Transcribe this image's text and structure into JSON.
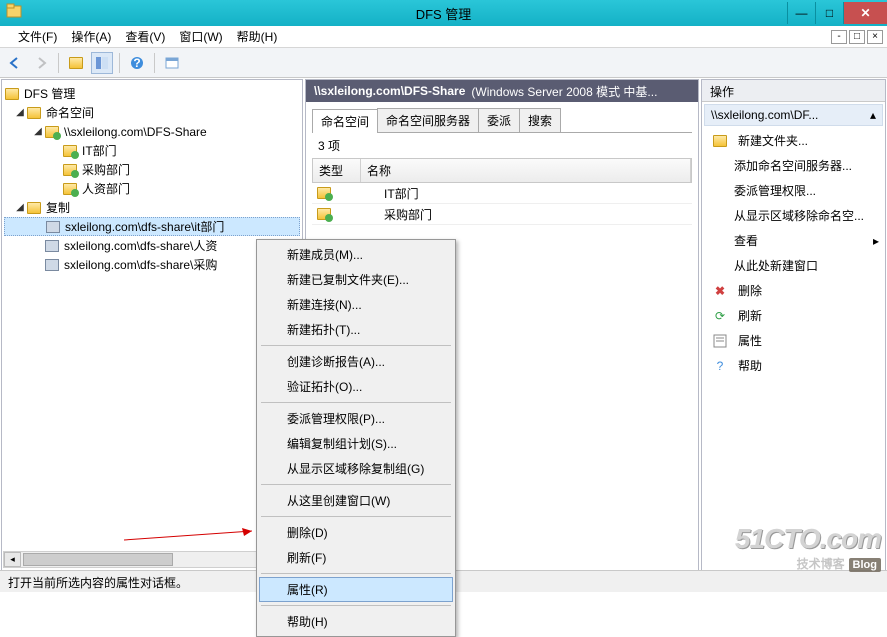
{
  "window": {
    "title": "DFS 管理"
  },
  "menu": {
    "file": "文件(F)",
    "action": "操作(A)",
    "view": "查看(V)",
    "window": "窗口(W)",
    "help": "帮助(H)"
  },
  "tree": {
    "root": "DFS 管理",
    "ns": "命名空间",
    "nsPath": "\\\\sxleilong.com\\DFS-Share",
    "nsChildren": [
      "IT部门",
      "采购部门",
      "人资部门"
    ],
    "rep": "复制",
    "repChildren": [
      "sxleilong.com\\dfs-share\\it部门",
      "sxleilong.com\\dfs-share\\人资",
      "sxleilong.com\\dfs-share\\采购"
    ]
  },
  "mid": {
    "path": "\\\\sxleilong.com\\DFS-Share",
    "sub": "(Windows Server 2008 模式 中基...",
    "tabs": [
      "命名空间",
      "命名空间服务器",
      "委派",
      "搜索"
    ],
    "count": "3 项",
    "cols": {
      "type": "类型",
      "name": "名称"
    },
    "rows": [
      "IT部门",
      "采购部门"
    ]
  },
  "actions": {
    "header": "操作",
    "group": "\\\\sxleilong.com\\DF...",
    "items": [
      "新建文件夹...",
      "添加命名空间服务器...",
      "委派管理权限...",
      "从显示区域移除命名空...",
      "查看",
      "从此处新建窗口",
      "删除",
      "刷新",
      "属性",
      "帮助"
    ]
  },
  "ctx": {
    "items1": [
      "新建成员(M)...",
      "新建已复制文件夹(E)...",
      "新建连接(N)...",
      "新建拓扑(T)..."
    ],
    "items2": [
      "创建诊断报告(A)...",
      "验证拓扑(O)..."
    ],
    "items3": [
      "委派管理权限(P)...",
      "编辑复制组计划(S)...",
      "从显示区域移除复制组(G)"
    ],
    "items4": [
      "从这里创建窗口(W)"
    ],
    "items5": [
      "删除(D)",
      "刷新(F)"
    ],
    "items6": [
      "属性(R)"
    ],
    "items7": [
      "帮助(H)"
    ]
  },
  "status": "打开当前所选内容的属性对话框。",
  "watermark": {
    "l1": "51CTO.com",
    "l2": "技术博客",
    "badge": "Blog"
  }
}
